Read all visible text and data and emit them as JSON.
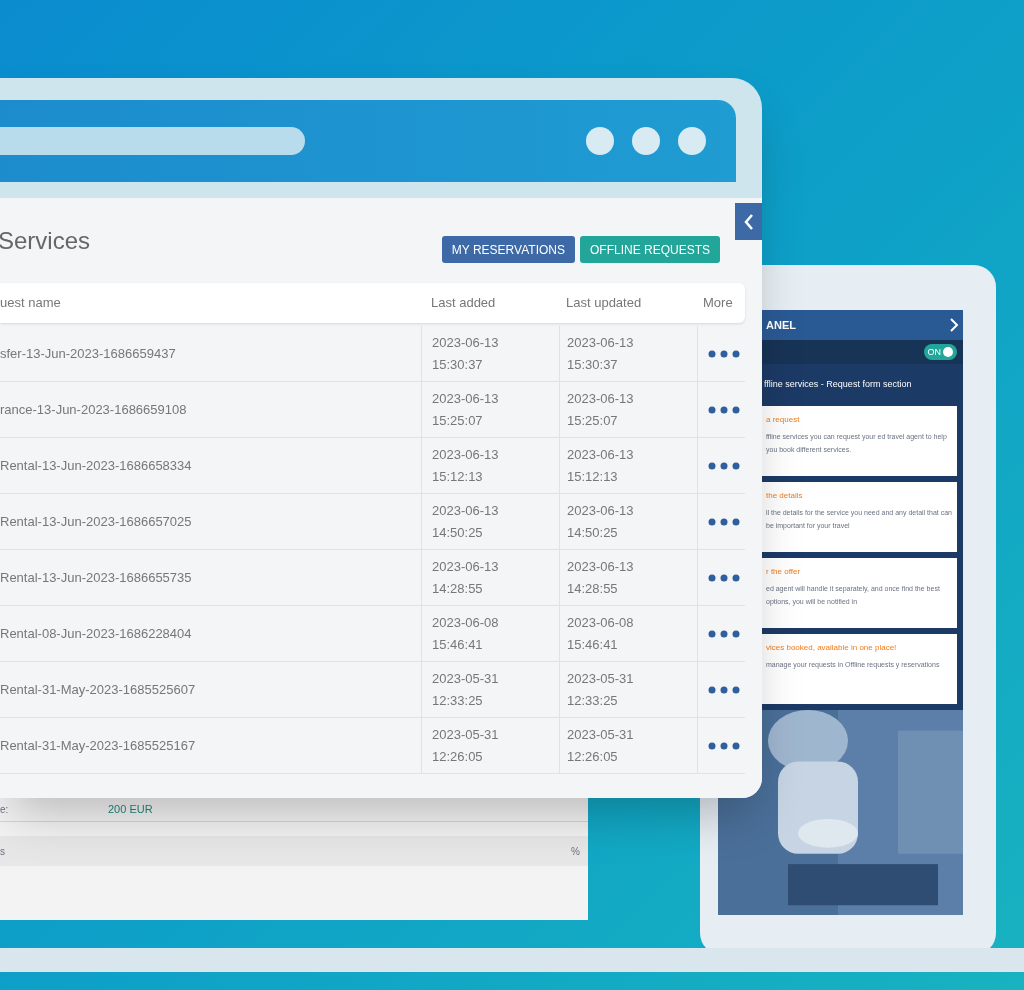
{
  "window": {
    "title": "Services",
    "buttons": [
      {
        "label": "MY RESERVATIONS",
        "kind": "primary"
      },
      {
        "label": "OFFLINE REQUESTS",
        "kind": "secondary"
      }
    ]
  },
  "table": {
    "columns": [
      "uest name",
      "Last added",
      "Last updated",
      "More"
    ],
    "rows": [
      {
        "name": "sfer-13-Jun-2023-1686659437",
        "added": "2023-06-13 15:30:37",
        "updated": "2023-06-13 15:30:37"
      },
      {
        "name": "rance-13-Jun-2023-1686659108",
        "added": "2023-06-13 15:25:07",
        "updated": "2023-06-13 15:25:07"
      },
      {
        "name": "Rental-13-Jun-2023-1686658334",
        "added": "2023-06-13 15:12:13",
        "updated": "2023-06-13 15:12:13"
      },
      {
        "name": "Rental-13-Jun-2023-1686657025",
        "added": "2023-06-13 14:50:25",
        "updated": "2023-06-13 14:50:25"
      },
      {
        "name": "Rental-13-Jun-2023-1686655735",
        "added": "2023-06-13 14:28:55",
        "updated": "2023-06-13 14:28:55"
      },
      {
        "name": "Rental-08-Jun-2023-1686228404",
        "added": "2023-06-08 15:46:41",
        "updated": "2023-06-08 15:46:41"
      },
      {
        "name": "Rental-31-May-2023-1685525607",
        "added": "2023-05-31 12:33:25",
        "updated": "2023-05-31 12:33:25"
      },
      {
        "name": "Rental-31-May-2023-1685525167",
        "added": "2023-05-31 12:26:05",
        "updated": "2023-05-31 12:26:05"
      }
    ]
  },
  "back_page": {
    "label": "e:",
    "value": "200 EUR",
    "field_label": "s",
    "field_suffix": "%"
  },
  "panel": {
    "title": "ANEL",
    "toggle": {
      "label": "ON",
      "on": true
    },
    "heading": "ffline services - Request form section",
    "cards": [
      {
        "title": "a request",
        "body": "ffline services you can request your ed travel agent to help you book different services."
      },
      {
        "title": "the details",
        "body": "ll the details for the service you need and any detail that can be important for your travel"
      },
      {
        "title": "r the offer",
        "body": "ed agent will handle it separately, and once find the best options, you will be notified in"
      },
      {
        "title": "vices booked, available in one place!",
        "body": "manage your requests in Offline requests y reservations"
      }
    ]
  }
}
